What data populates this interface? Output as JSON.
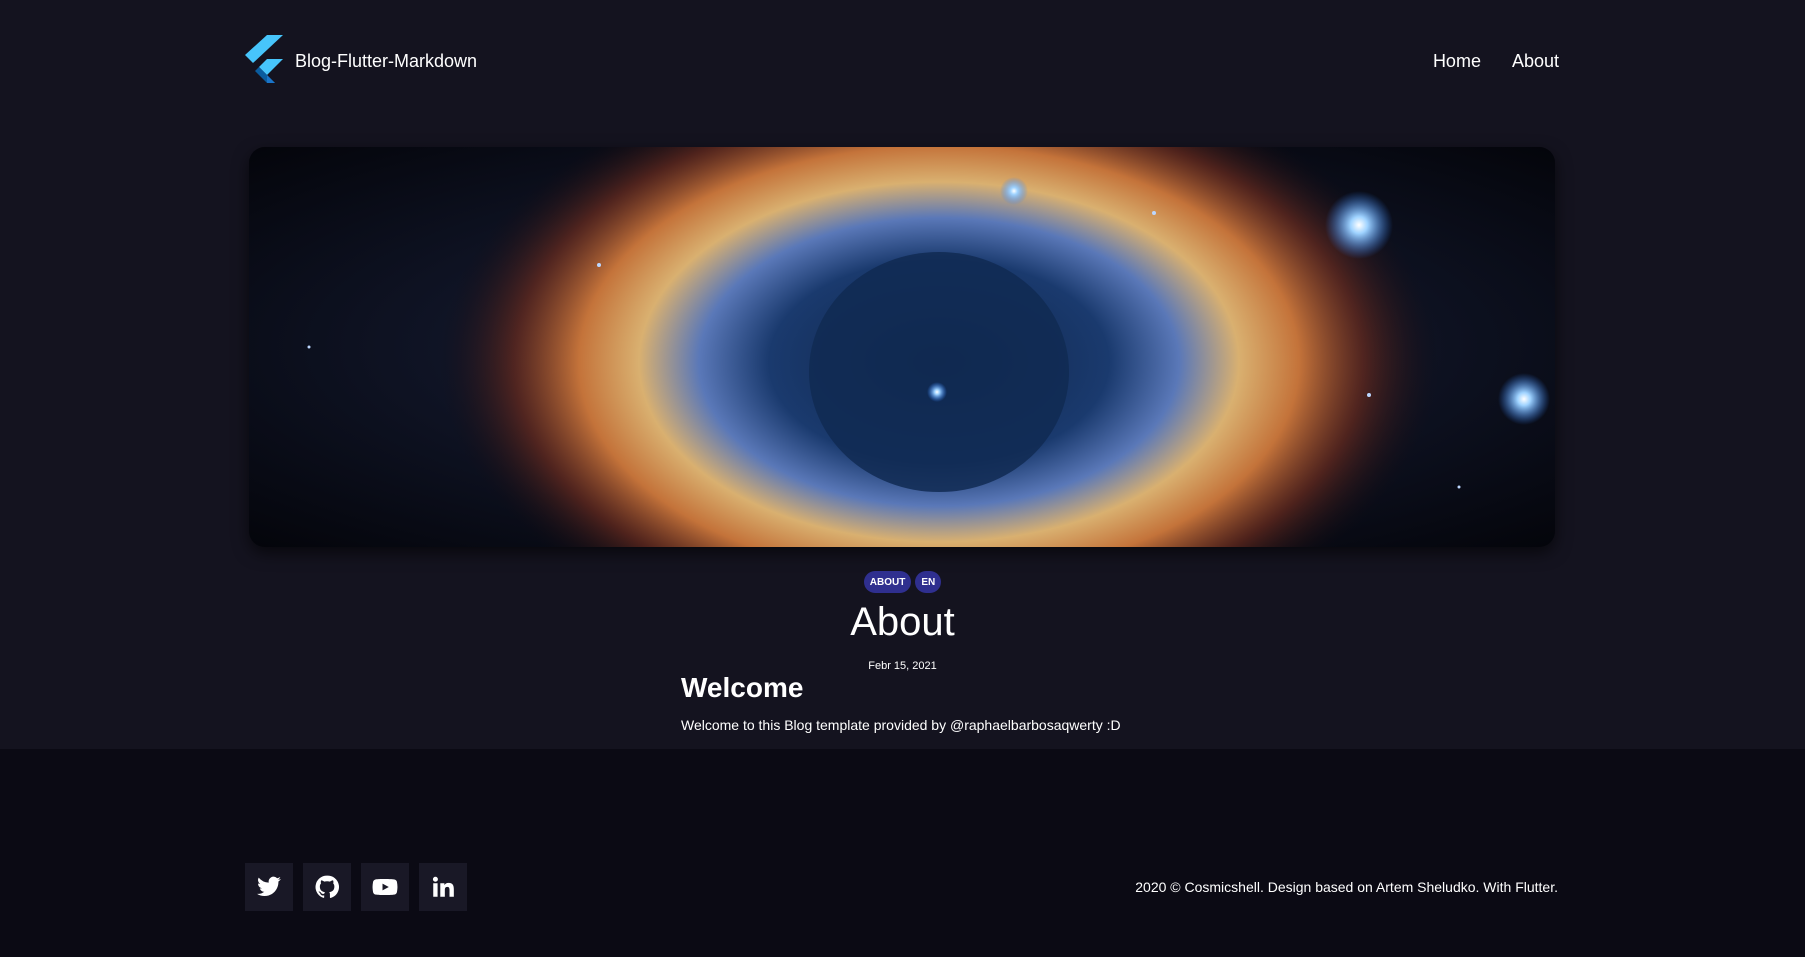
{
  "header": {
    "brand_title": "Blog-Flutter-Markdown",
    "nav": [
      "Home",
      "About"
    ]
  },
  "post": {
    "tags": [
      "ABOUT",
      "EN"
    ],
    "title": "About",
    "date": "Febr 15, 2021",
    "heading": "Welcome",
    "body": "Welcome to this Blog template provided by @raphaelbarbosaqwerty :D"
  },
  "footer": {
    "socials": [
      "twitter-icon",
      "github-icon",
      "youtube-icon",
      "linkedin-icon"
    ],
    "copyright": "2020 © Cosmicshell. Design based on Artem Sheludko. With Flutter."
  },
  "colors": {
    "background": "#14131f",
    "footer_background": "#0b0a14",
    "tag": "#2f2f8f",
    "flutter_light": "#47c5fb",
    "flutter_dark": "#0a5c9e"
  }
}
